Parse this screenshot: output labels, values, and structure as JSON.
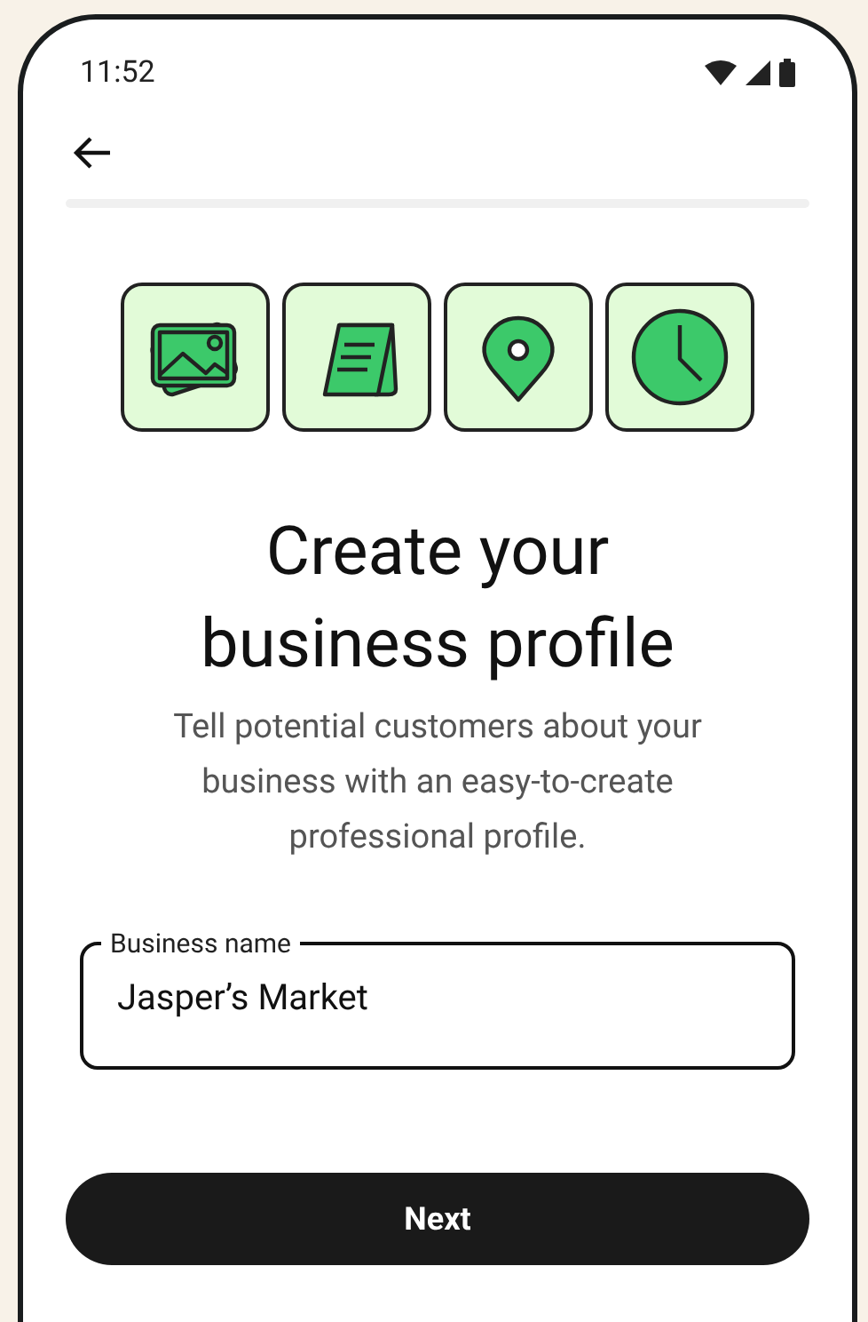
{
  "status_bar": {
    "time": "11:52"
  },
  "features": [
    {
      "kind": "photos"
    },
    {
      "kind": "sign"
    },
    {
      "kind": "pin"
    },
    {
      "kind": "clock"
    }
  ],
  "title": "Create your business profile",
  "description": "Tell potential customers about your business with an easy-to-create professional profile.",
  "field": {
    "label": "Business name",
    "value": "Jasper’s Market"
  },
  "button": {
    "label": "Next"
  }
}
